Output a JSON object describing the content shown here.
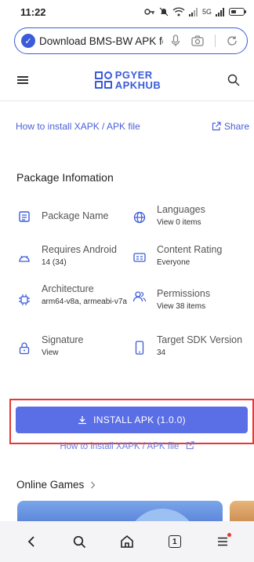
{
  "status_bar": {
    "time": "11:22",
    "network": "5G"
  },
  "browser": {
    "url_text": "Download BMS-BW APK fc",
    "tab_count": "1"
  },
  "site": {
    "logo_line1": "PGYER",
    "logo_line2": "APKHUB"
  },
  "content": {
    "install_link": "How to install XAPK / APK file",
    "share_label": "Share",
    "section_title": "Package Infomation",
    "info": [
      {
        "label": "Package Name",
        "value": "",
        "icon": "document-icon"
      },
      {
        "label": "Languages",
        "value": "View 0 items",
        "icon": "globe-icon"
      },
      {
        "label": "Requires Android",
        "value": "14 (34)",
        "icon": "android-icon"
      },
      {
        "label": "Content Rating",
        "value": "Everyone",
        "icon": "id-card-icon"
      },
      {
        "label": "Architecture",
        "value": "arm64-v8a, armeabi-v7a",
        "icon": "chip-icon"
      },
      {
        "label": "Permissions",
        "value": "View 38 items",
        "icon": "users-icon"
      },
      {
        "label": "Signature",
        "value": "View",
        "icon": "lock-icon"
      },
      {
        "label": "Target SDK Version",
        "value": "34",
        "icon": "phone-icon"
      }
    ],
    "install_button": "INSTALL APK (1.0.0)",
    "install_link_2": "How to install XAPK / APK file",
    "online_games": "Online Games"
  },
  "colors": {
    "accent": "#3b5bdb",
    "button": "#5a6ee6",
    "highlight": "#e53935"
  }
}
